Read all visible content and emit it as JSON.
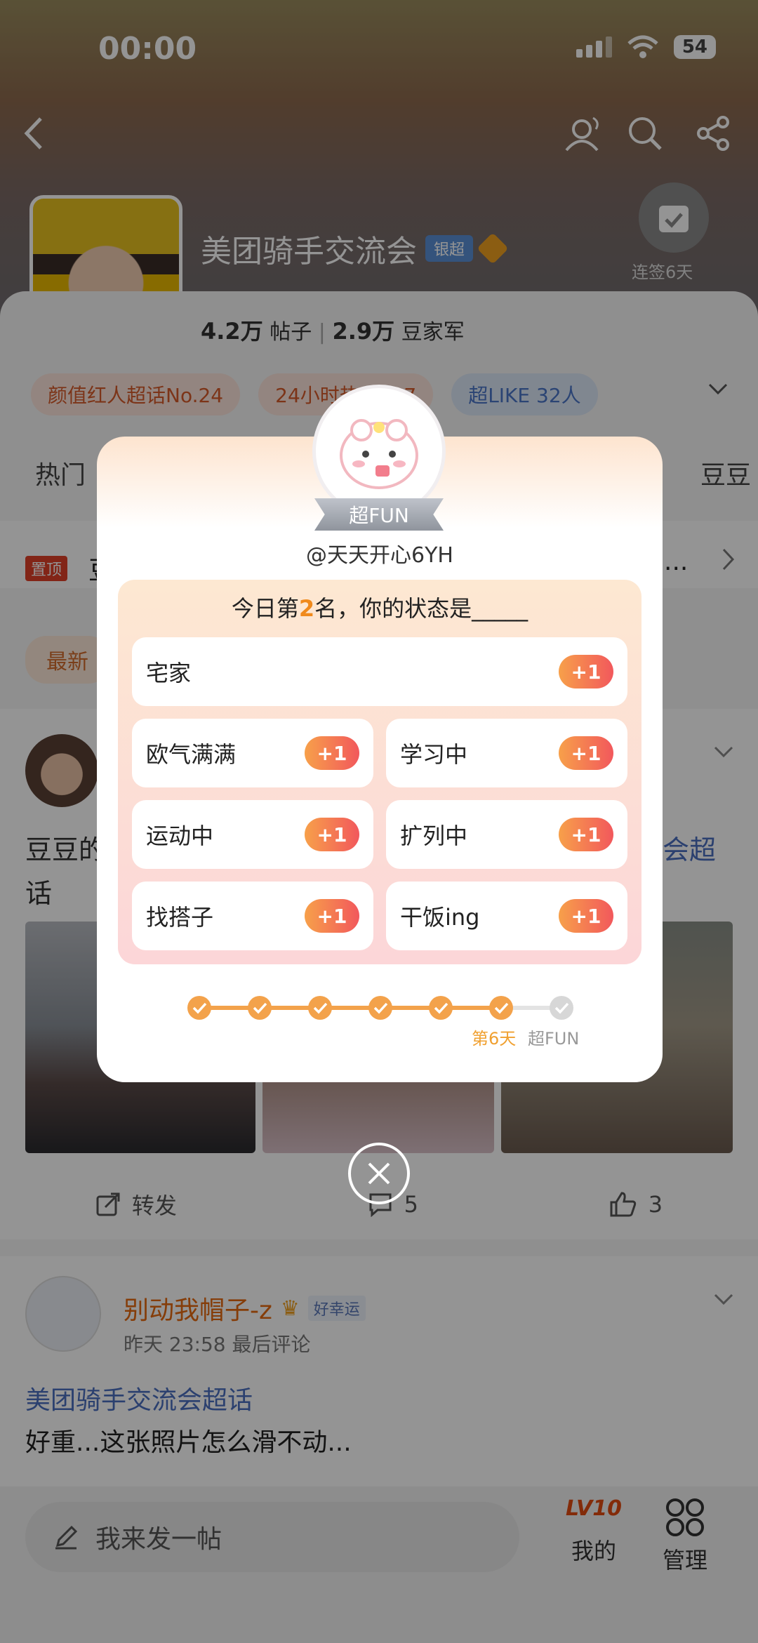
{
  "status_bar": {
    "time": "00:00",
    "battery": "54"
  },
  "topic": {
    "title": "美团骑手交流会",
    "badge": "银超",
    "stats": {
      "posts_num": "4.2万",
      "posts_label": "帖子",
      "members_num": "2.9万",
      "members_label": "豆家军"
    },
    "checkin_label": "连签6天",
    "chips": [
      "颜值红人超话No.24",
      "24小时热度967",
      "超LIKE 32人"
    ],
    "tabs_left": "热门",
    "tabs_right": "豆豆"
  },
  "pinned": {
    "tag": "置顶",
    "title_fragment": "豆",
    "ellipsis": "..."
  },
  "sort_tag": "最新",
  "post1": {
    "text_left1": "豆豆的",
    "text_left2": "话",
    "text_right": "会超"
  },
  "actions": {
    "repost": "转发",
    "comments": "5",
    "likes": "3"
  },
  "post2": {
    "username": "别动我帽子-z",
    "luck_badge": "好幸运",
    "meta": "昨天 23:58 最后评论",
    "topic_tag": "美团骑手交流会超话",
    "text": "好重...这张照片怎么滑不动..."
  },
  "bottom_bar": {
    "composer": "我来发一帖",
    "mine_level": "LV10",
    "mine_label": "我的",
    "manage_label": "管理"
  },
  "modal": {
    "ribbon": "超FUN",
    "handle": "@天天开心6YH",
    "question_pre": "今日第",
    "rank": "2",
    "question_post": "名，你的状态是_____",
    "plus_label": "+1",
    "options": [
      "宅家",
      "欧气满满",
      "学习中",
      "运动中",
      "扩列中",
      "找搭子",
      "干饭ing"
    ],
    "progress": {
      "completed_steps": 6,
      "total_steps": 7,
      "current_label": "第6天",
      "goal_label": "超FUN"
    }
  },
  "colors": {
    "accent_orange": "#f3a24b",
    "plus_gradient_end": "#f2585c",
    "link_blue": "#4a6fc0"
  }
}
